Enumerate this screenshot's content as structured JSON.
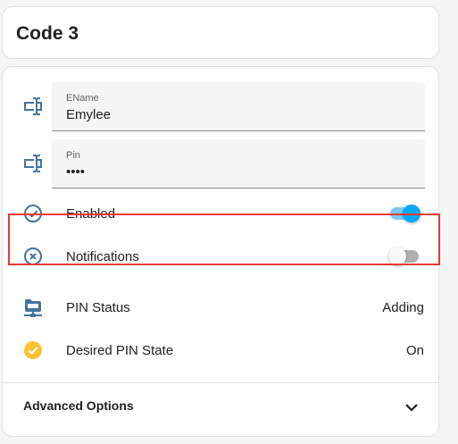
{
  "title": "Code 3",
  "fields": {
    "name": {
      "label": "EName",
      "value": "Emylee"
    },
    "pin": {
      "label": "Pin",
      "value": "••••"
    }
  },
  "rows": {
    "enabled": {
      "label": "Enabled",
      "state": "on",
      "icon": "check-circle-outline-icon"
    },
    "notifications": {
      "label": "Notifications",
      "state": "off",
      "icon": "close-circle-outline-icon"
    },
    "pin_status": {
      "label": "PIN Status",
      "value": "Adding",
      "icon": "folder-network-icon"
    },
    "desired_pin_state": {
      "label": "Desired PIN State",
      "value": "On",
      "icon": "check-circle-icon"
    }
  },
  "advanced": {
    "label": "Advanced Options",
    "icon": "chevron-down-icon"
  },
  "colors": {
    "icon_blue": "#44739e",
    "toggle_on": "#03a9f4",
    "check_yellow": "#fdc22f",
    "highlight_red": "#e53935"
  }
}
